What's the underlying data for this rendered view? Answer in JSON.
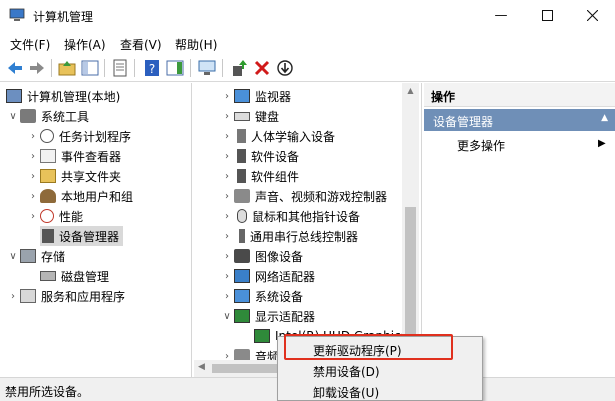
{
  "window": {
    "title": "计算机管理"
  },
  "menu": [
    "文件(F)",
    "操作(A)",
    "查看(V)",
    "帮助(H)"
  ],
  "tree": {
    "root": "计算机管理(本地)",
    "system_tools": "系统工具",
    "task_scheduler": "任务计划程序",
    "event_viewer": "事件查看器",
    "shared_folders": "共享文件夹",
    "local_users": "本地用户和组",
    "performance": "性能",
    "device_manager": "设备管理器",
    "storage": "存储",
    "disk_management": "磁盘管理",
    "services_apps": "服务和应用程序"
  },
  "devices": [
    "监视器",
    "键盘",
    "人体学输入设备",
    "软件设备",
    "软件组件",
    "声音、视频和游戏控制器",
    "鼠标和其他指针设备",
    "通用串行总线控制器",
    "图像设备",
    "网络适配器",
    "系统设备",
    "显示适配器",
    "Intel(R) UHD Graphics",
    "音频"
  ],
  "actions": {
    "header": "操作",
    "section": "设备管理器",
    "more": "更多操作"
  },
  "context_menu": {
    "update_driver": "更新驱动程序(P)",
    "disable_device": "禁用设备(D)",
    "uninstall_device": "卸载设备(U)"
  },
  "status": "禁用所选设备。",
  "colors": {
    "section_header": "#6f8fb7",
    "highlight_box": "#e0301e",
    "selection": "#d9d9d9"
  }
}
